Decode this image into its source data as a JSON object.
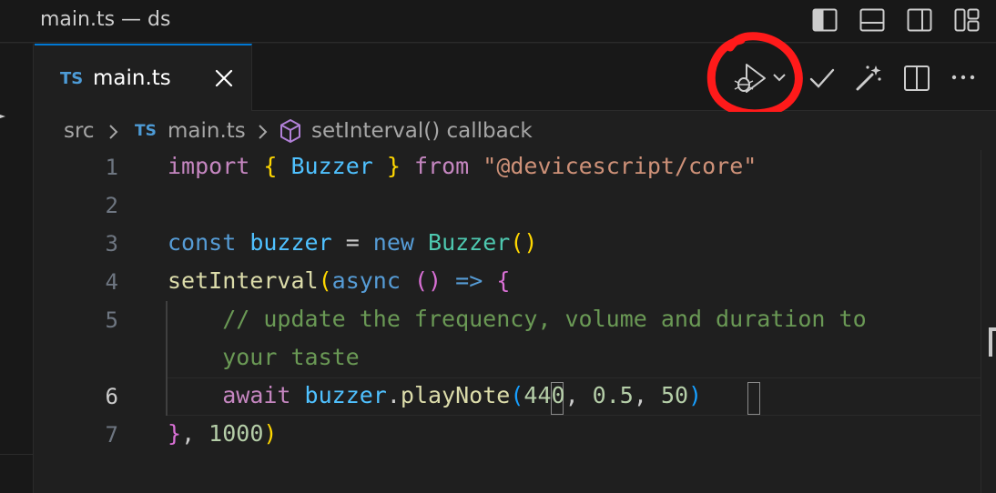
{
  "window": {
    "title": "main.ts — ds",
    "layout_icons": [
      "toggle-primary-sidebar-icon",
      "toggle-panel-icon",
      "toggle-secondary-sidebar-icon",
      "customize-layout-icon"
    ]
  },
  "tab": {
    "lang_badge": "TS",
    "label": "main.ts",
    "active": true
  },
  "editor_actions": [
    "run-debug-icon",
    "chevron-down-icon",
    "check-icon",
    "magic-wand-icon",
    "split-editor-icon",
    "more-actions-icon"
  ],
  "annotation_color": "#ff1a1a",
  "accent_color": "#0078d4",
  "breadcrumb": {
    "folder": "src",
    "file_badge": "TS",
    "file": "main.ts",
    "symbol": "setInterval() callback"
  },
  "editor": {
    "active_line": "6",
    "lines": [
      {
        "number": "1",
        "tokens": [
          {
            "t": "import",
            "c": "kw"
          },
          {
            "t": " ",
            "c": "plain"
          },
          {
            "t": "{",
            "c": "br1"
          },
          {
            "t": " Buzzer ",
            "c": "var"
          },
          {
            "t": "}",
            "c": "br1"
          },
          {
            "t": " ",
            "c": "plain"
          },
          {
            "t": "from",
            "c": "kw"
          },
          {
            "t": " ",
            "c": "plain"
          },
          {
            "t": "\"@devicescript/core\"",
            "c": "str"
          }
        ]
      },
      {
        "number": "2",
        "tokens": []
      },
      {
        "number": "3",
        "tokens": [
          {
            "t": "const",
            "c": "kwb"
          },
          {
            "t": " ",
            "c": "plain"
          },
          {
            "t": "buzzer",
            "c": "var"
          },
          {
            "t": " = ",
            "c": "plain"
          },
          {
            "t": "new",
            "c": "kwb"
          },
          {
            "t": " ",
            "c": "plain"
          },
          {
            "t": "Buzzer",
            "c": "cls"
          },
          {
            "t": "()",
            "c": "br1"
          }
        ]
      },
      {
        "number": "4",
        "tokens": [
          {
            "t": "setInterval",
            "c": "fn"
          },
          {
            "t": "(",
            "c": "br1"
          },
          {
            "t": "async",
            "c": "kwb"
          },
          {
            "t": " ",
            "c": "plain"
          },
          {
            "t": "()",
            "c": "br2"
          },
          {
            "t": " ",
            "c": "plain"
          },
          {
            "t": "=>",
            "c": "kwb"
          },
          {
            "t": " ",
            "c": "plain"
          },
          {
            "t": "{",
            "c": "br2"
          }
        ]
      },
      {
        "number": "5",
        "tokens": [
          {
            "t": "    // update the frequency, volume and duration to",
            "c": "cmt"
          }
        ]
      },
      {
        "number": "",
        "tokens": [
          {
            "t": "    your taste",
            "c": "cmt"
          }
        ]
      },
      {
        "number": "6",
        "tokens": [
          {
            "t": "    ",
            "c": "plain"
          },
          {
            "t": "await",
            "c": "kw"
          },
          {
            "t": " ",
            "c": "plain"
          },
          {
            "t": "buzzer",
            "c": "var"
          },
          {
            "t": ".",
            "c": "plain"
          },
          {
            "t": "playNote",
            "c": "fn"
          },
          {
            "t": "(",
            "c": "br3"
          },
          {
            "t": "440",
            "c": "num"
          },
          {
            "t": ", ",
            "c": "plain"
          },
          {
            "t": "0.5",
            "c": "num"
          },
          {
            "t": ", ",
            "c": "plain"
          },
          {
            "t": "50",
            "c": "num"
          },
          {
            "t": ")",
            "c": "br3"
          }
        ]
      },
      {
        "number": "7",
        "tokens": [
          {
            "t": "}",
            "c": "br2"
          },
          {
            "t": ", ",
            "c": "plain"
          },
          {
            "t": "1000",
            "c": "num"
          },
          {
            "t": ")",
            "c": "br1"
          }
        ]
      }
    ]
  }
}
